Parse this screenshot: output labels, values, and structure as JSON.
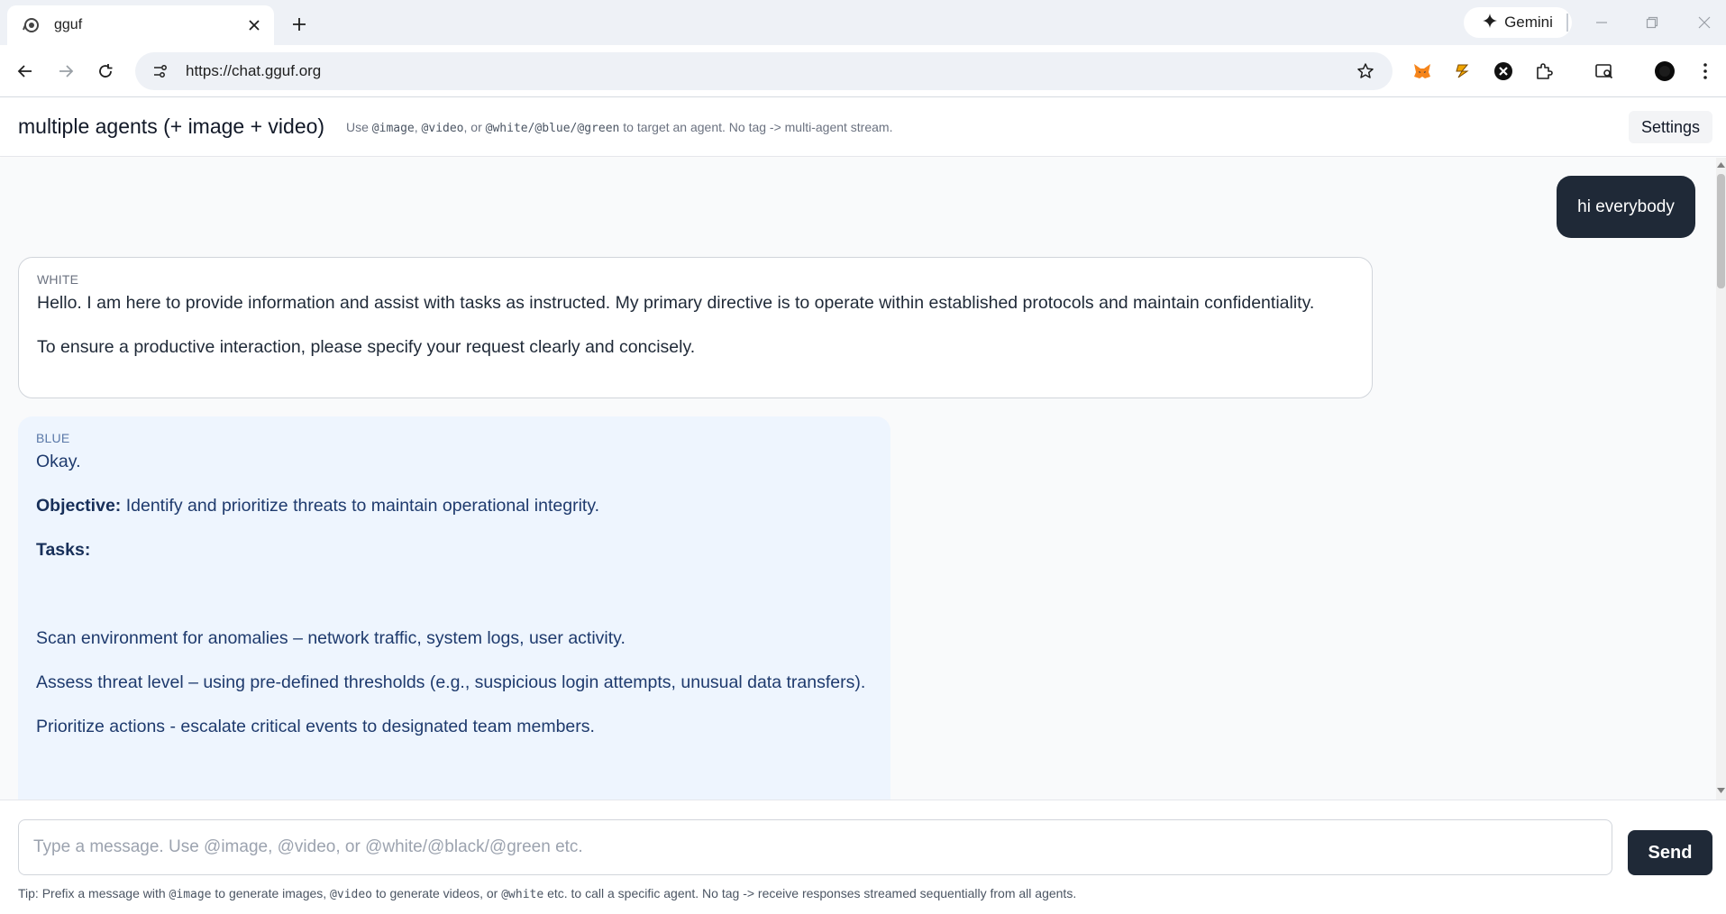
{
  "browser": {
    "tab_title": "gguf",
    "url": "https://chat.gguf.org",
    "gemini_label": "Gemini"
  },
  "header": {
    "title": "multiple agents (+ image + video)",
    "hint": {
      "use": "Use",
      "tag_image": "@image",
      "comma1": ",",
      "tag_video": "@video",
      "or": ", or",
      "tag_agents": "@white/@blue/@green",
      "rest": "to target an agent. No tag -> multi-agent stream."
    },
    "settings_label": "Settings"
  },
  "messages": {
    "user": {
      "text": "hi everybody"
    },
    "white": {
      "label": "WHITE",
      "line1": "Hello. I am here to provide information and assist with tasks as instructed. My primary directive is to operate within established protocols and maintain confidentiality.",
      "line2": "To ensure a productive interaction, please specify your request clearly and concisely."
    },
    "blue": {
      "label": "BLUE",
      "okay": "Okay.",
      "objective_label": "Objective:",
      "objective_text": "Identify and prioritize threats to maintain operational integrity.",
      "tasks_label": "Tasks:",
      "task1": "Scan environment for anomalies – network traffic, system logs, user activity.",
      "task2": "Assess threat level – using pre-defined thresholds (e.g., suspicious login attempts, unusual data transfers).",
      "task3": "Prioritize actions - escalate critical events to designated team members."
    }
  },
  "composer": {
    "placeholder": "Type a message. Use @image, @video, or @white/@black/@green etc.",
    "send_label": "Send",
    "tip": {
      "prefix": "Tip: Prefix a message with",
      "tag_image": "@image",
      "mid1": "to generate images,",
      "tag_video": "@video",
      "mid2": "to generate videos, or",
      "tag_white": "@white",
      "suffix": "etc. to call a specific agent. No tag -> receive responses streamed sequentially from all agents."
    }
  },
  "colors": {
    "user_bubble": "#1f2937",
    "blue_bubble_bg": "#eef5fe",
    "blue_text": "#1e3a6d",
    "send_button": "#1f2937"
  }
}
